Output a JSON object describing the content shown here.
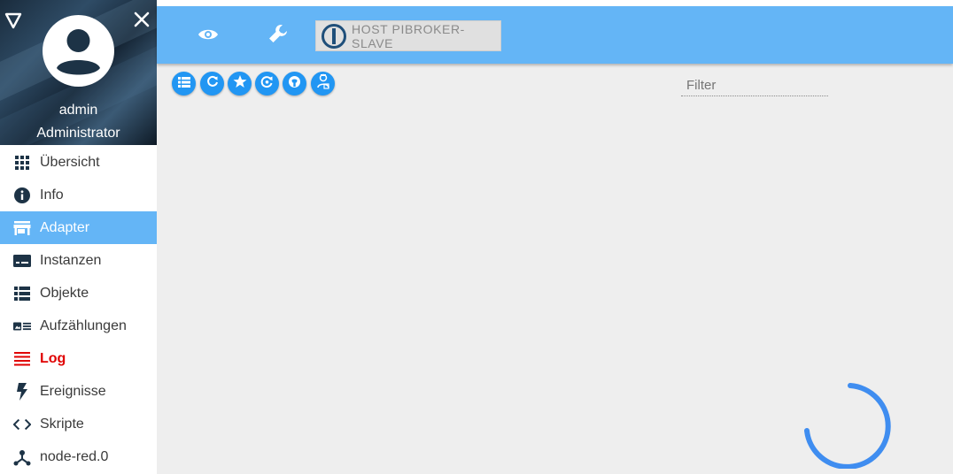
{
  "user": {
    "name": "admin",
    "role": "Administrator"
  },
  "menu": {
    "items": [
      {
        "label": "Übersicht",
        "icon": "grid-icon"
      },
      {
        "label": "Info",
        "icon": "info-icon"
      },
      {
        "label": "Adapter",
        "icon": "store-icon",
        "active": true
      },
      {
        "label": "Instanzen",
        "icon": "subtitles-icon"
      },
      {
        "label": "Objekte",
        "icon": "list-icon"
      },
      {
        "label": "Aufzählungen",
        "icon": "enum-icon"
      },
      {
        "label": "Log",
        "icon": "log-lines-icon",
        "color": "#e00000"
      },
      {
        "label": "Ereignisse",
        "icon": "flash-icon"
      },
      {
        "label": "Skripte",
        "icon": "code-icon"
      },
      {
        "label": "node-red.0",
        "icon": "node-red-icon"
      }
    ]
  },
  "header": {
    "host": "HOST PIBROKER-SLAVE"
  },
  "toolbar": {
    "buttons": [
      "list-view-icon",
      "refresh-icon",
      "star-icon",
      "update-icon",
      "github-icon",
      "expert-mode-icon"
    ]
  },
  "filter": {
    "placeholder": "Filter",
    "value": ""
  },
  "colors": {
    "accent": "#64b5f6",
    "button": "#2196f3",
    "log": "#e00000",
    "spinner": "#3f8df0"
  }
}
